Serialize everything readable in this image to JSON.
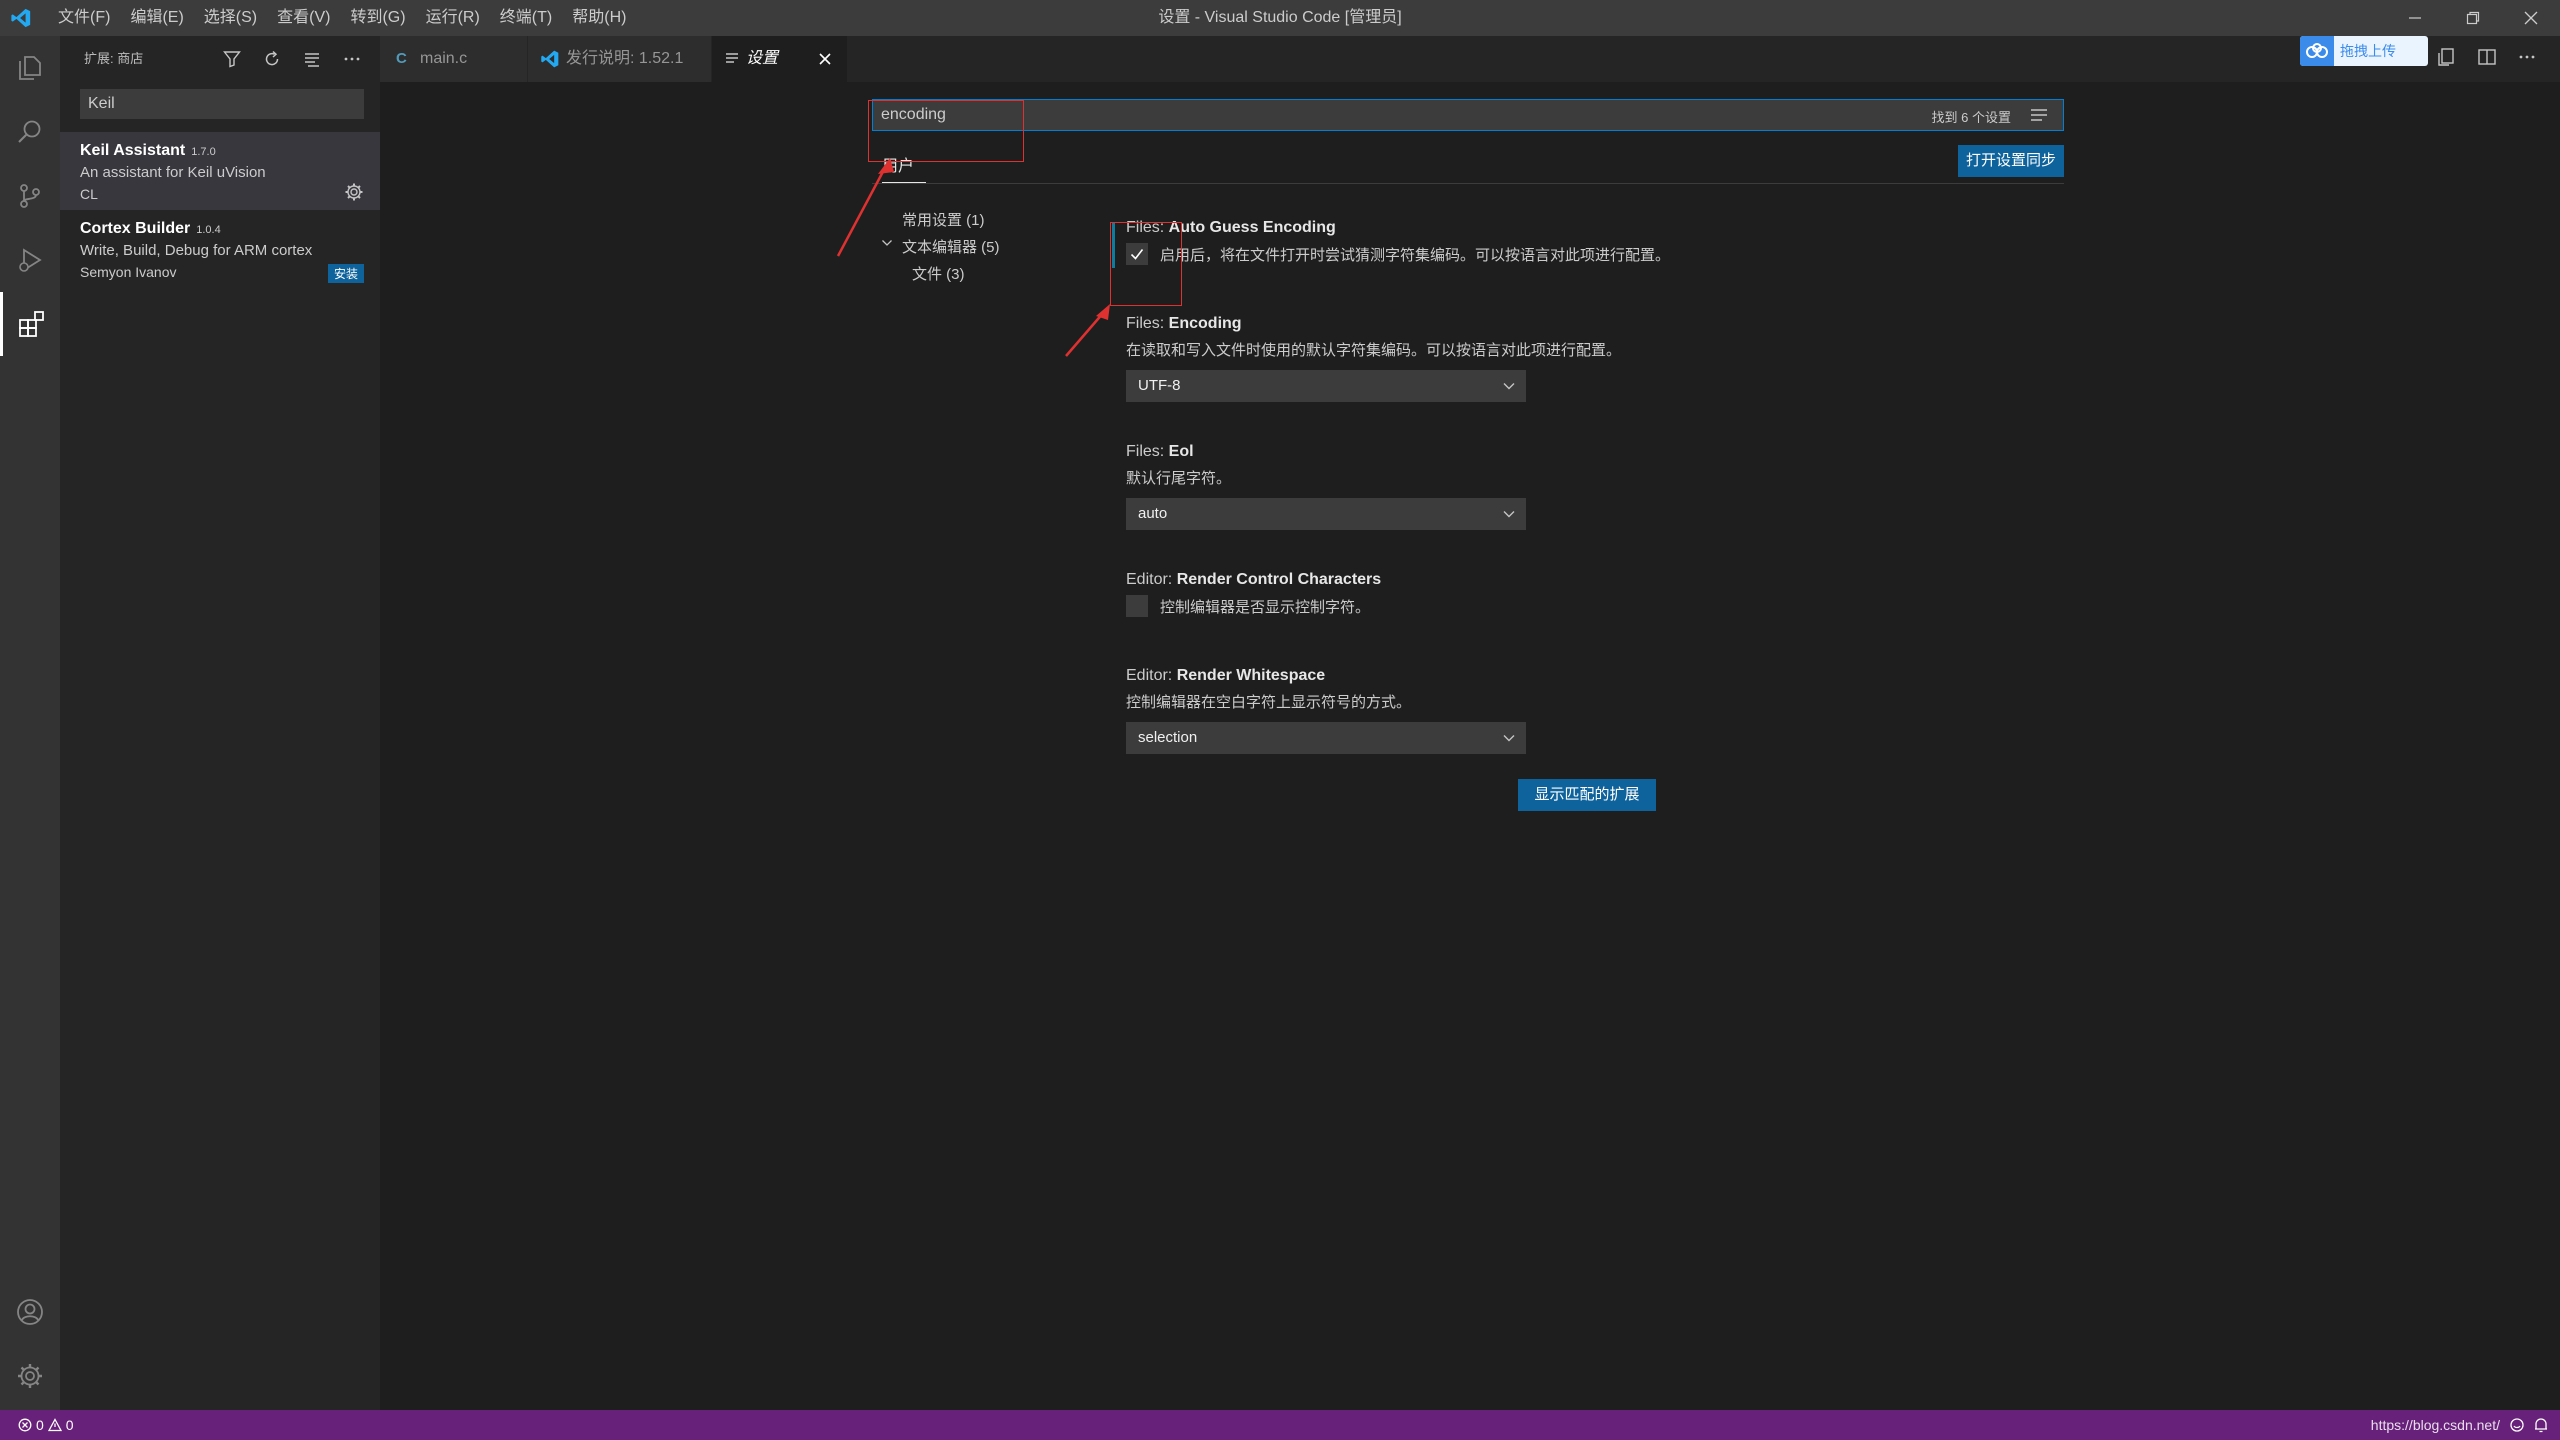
{
  "window": {
    "title": "设置 - Visual Studio Code [管理员]",
    "menu": [
      "文件(F)",
      "编辑(E)",
      "选择(S)",
      "查看(V)",
      "转到(G)",
      "运行(R)",
      "终端(T)",
      "帮助(H)"
    ]
  },
  "sidebar": {
    "title": "扩展: 商店",
    "search_value": "Keil",
    "extensions": [
      {
        "name": "Keil Assistant",
        "version": "1.7.0",
        "description": "An assistant for Keil uVision",
        "publisher": "CL",
        "action": ""
      },
      {
        "name": "Cortex Builder",
        "version": "1.0.4",
        "description": "Write, Build, Debug for ARM cortex",
        "publisher": "Semyon Ivanov",
        "action": "安装"
      }
    ]
  },
  "tabs": [
    {
      "icon": "C",
      "label": "main.c"
    },
    {
      "icon": "vscode-icon",
      "label": "发行说明: 1.52.1"
    },
    {
      "icon": "settings-icon",
      "label": "设置"
    }
  ],
  "baidu": {
    "label": "拖拽上传"
  },
  "settings": {
    "search_value": "encoding",
    "result_count": "找到 6 个设置",
    "scope_tab": "用户",
    "sync_button": "打开设置同步",
    "toc": [
      "常用设置 (1)",
      "文本编辑器 (5)",
      "文件 (3)"
    ],
    "items": [
      {
        "prefix": "Files: ",
        "name": "Auto Guess Encoding",
        "checkbox_label": "启用后，将在文件打开时尝试猜测字符集编码。可以按语言对此项进行配置。",
        "checked": true
      },
      {
        "prefix": "Files: ",
        "name": "Encoding",
        "description": "在读取和写入文件时使用的默认字符集编码。可以按语言对此项进行配置。",
        "value": "UTF-8"
      },
      {
        "prefix": "Files: ",
        "name": "Eol",
        "description": "默认行尾字符。",
        "value": "auto"
      },
      {
        "prefix": "Editor: ",
        "name": "Render Control Characters",
        "checkbox_label": "控制编辑器是否显示控制字符。",
        "checked": false
      },
      {
        "prefix": "Editor: ",
        "name": "Render Whitespace",
        "description": "控制编辑器在空白字符上显示符号的方式。",
        "value": "selection"
      }
    ],
    "show_extensions_button": "显示匹配的扩展"
  },
  "statusbar": {
    "errors": "0",
    "warnings": "0",
    "url": "https://blog.csdn.net/"
  },
  "colors": {
    "accent": "#0e639c",
    "statusbar": "#68217a",
    "annotation": "#e03131"
  }
}
